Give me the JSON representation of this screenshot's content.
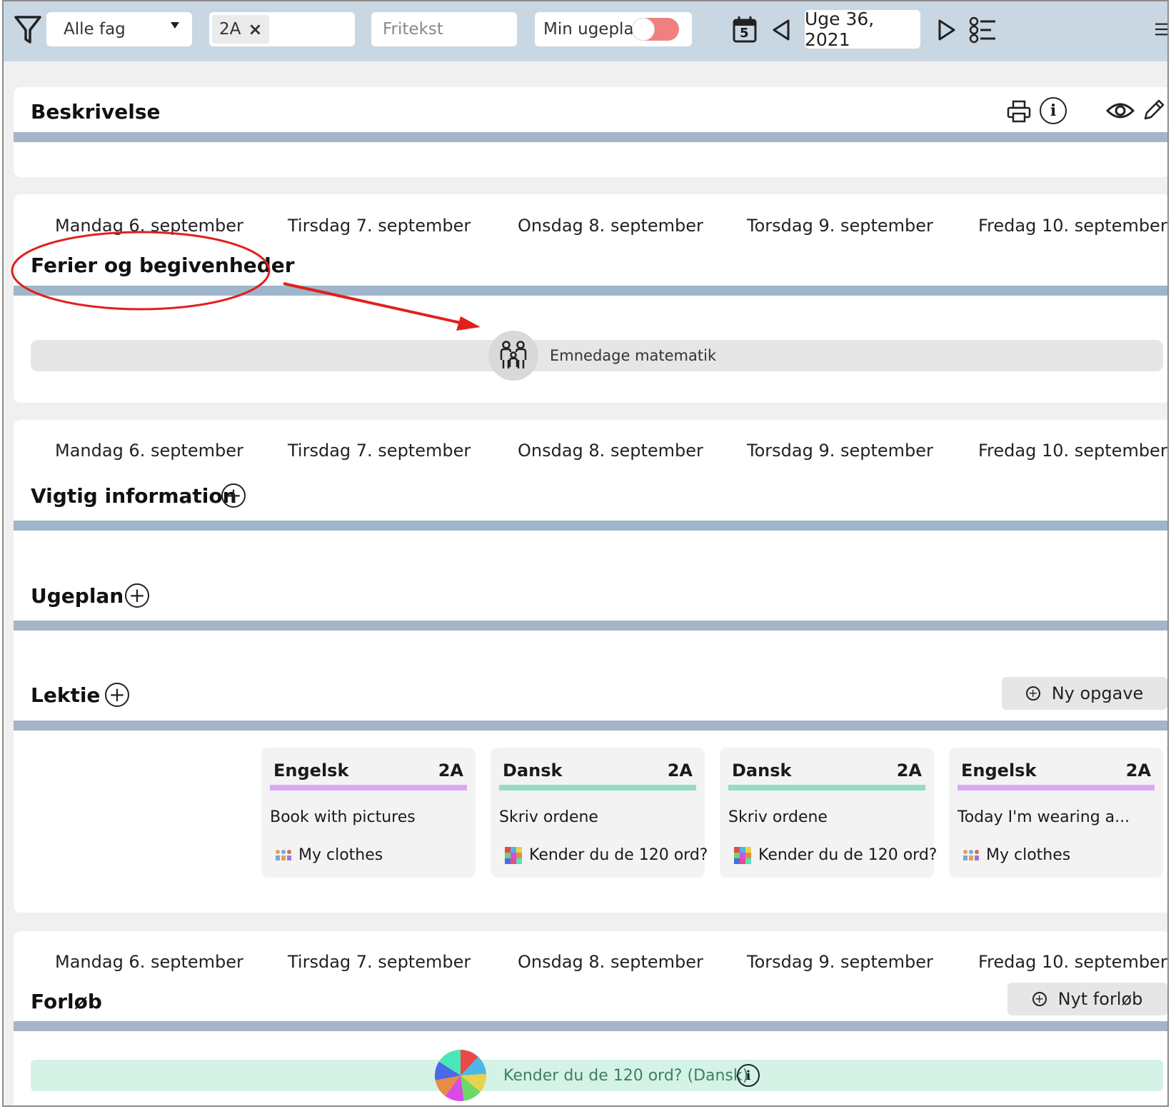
{
  "toolbar": {
    "subject_select": "Alle fag",
    "class_chip": "2A",
    "search_placeholder": "Fritekst",
    "my_plan_label": "Min ugeplan",
    "calendar_day": "5",
    "week_label": "Uge 36, 2021"
  },
  "description": {
    "title": "Beskrivelse"
  },
  "days": [
    "Mandag 6. september",
    "Tirsdag 7. september",
    "Onsdag 8. september",
    "Torsdag 9. september",
    "Fredag 10. september"
  ],
  "events": {
    "title": "Ferier og begivenheder",
    "items": [
      {
        "label": "Emnedage matematik"
      }
    ]
  },
  "important": {
    "title": "Vigtig information"
  },
  "weekplan": {
    "title": "Ugeplan"
  },
  "homework": {
    "title": "Lektie",
    "new_task_label": "Ny opgave",
    "cards": [
      {
        "subject": "Engelsk",
        "class": "2A",
        "title": "Book with pictures",
        "course": "My clothes",
        "color": "#dba8f0"
      },
      {
        "subject": "Dansk",
        "class": "2A",
        "title": "Skriv ordene",
        "course": "Kender du de 120 ord?",
        "color": "#96dcc0"
      },
      {
        "subject": "Dansk",
        "class": "2A",
        "title": "Skriv ordene",
        "course": "Kender du de 120 ord?",
        "color": "#96dcc0"
      },
      {
        "subject": "Engelsk",
        "class": "2A",
        "title": "Today I'm wearing a...",
        "course": "My clothes",
        "color": "#dba8f0"
      }
    ]
  },
  "courses": {
    "title": "Forløb",
    "new_course_label": "Nyt forløb",
    "items": [
      {
        "label": "Kender du de 120 ord? (Dansk)"
      }
    ]
  },
  "colors": {
    "topbar": "#c9d7e3",
    "toggle": "#f08080",
    "annotation": "#e0201c",
    "course_bar": "#d4f3e6"
  }
}
